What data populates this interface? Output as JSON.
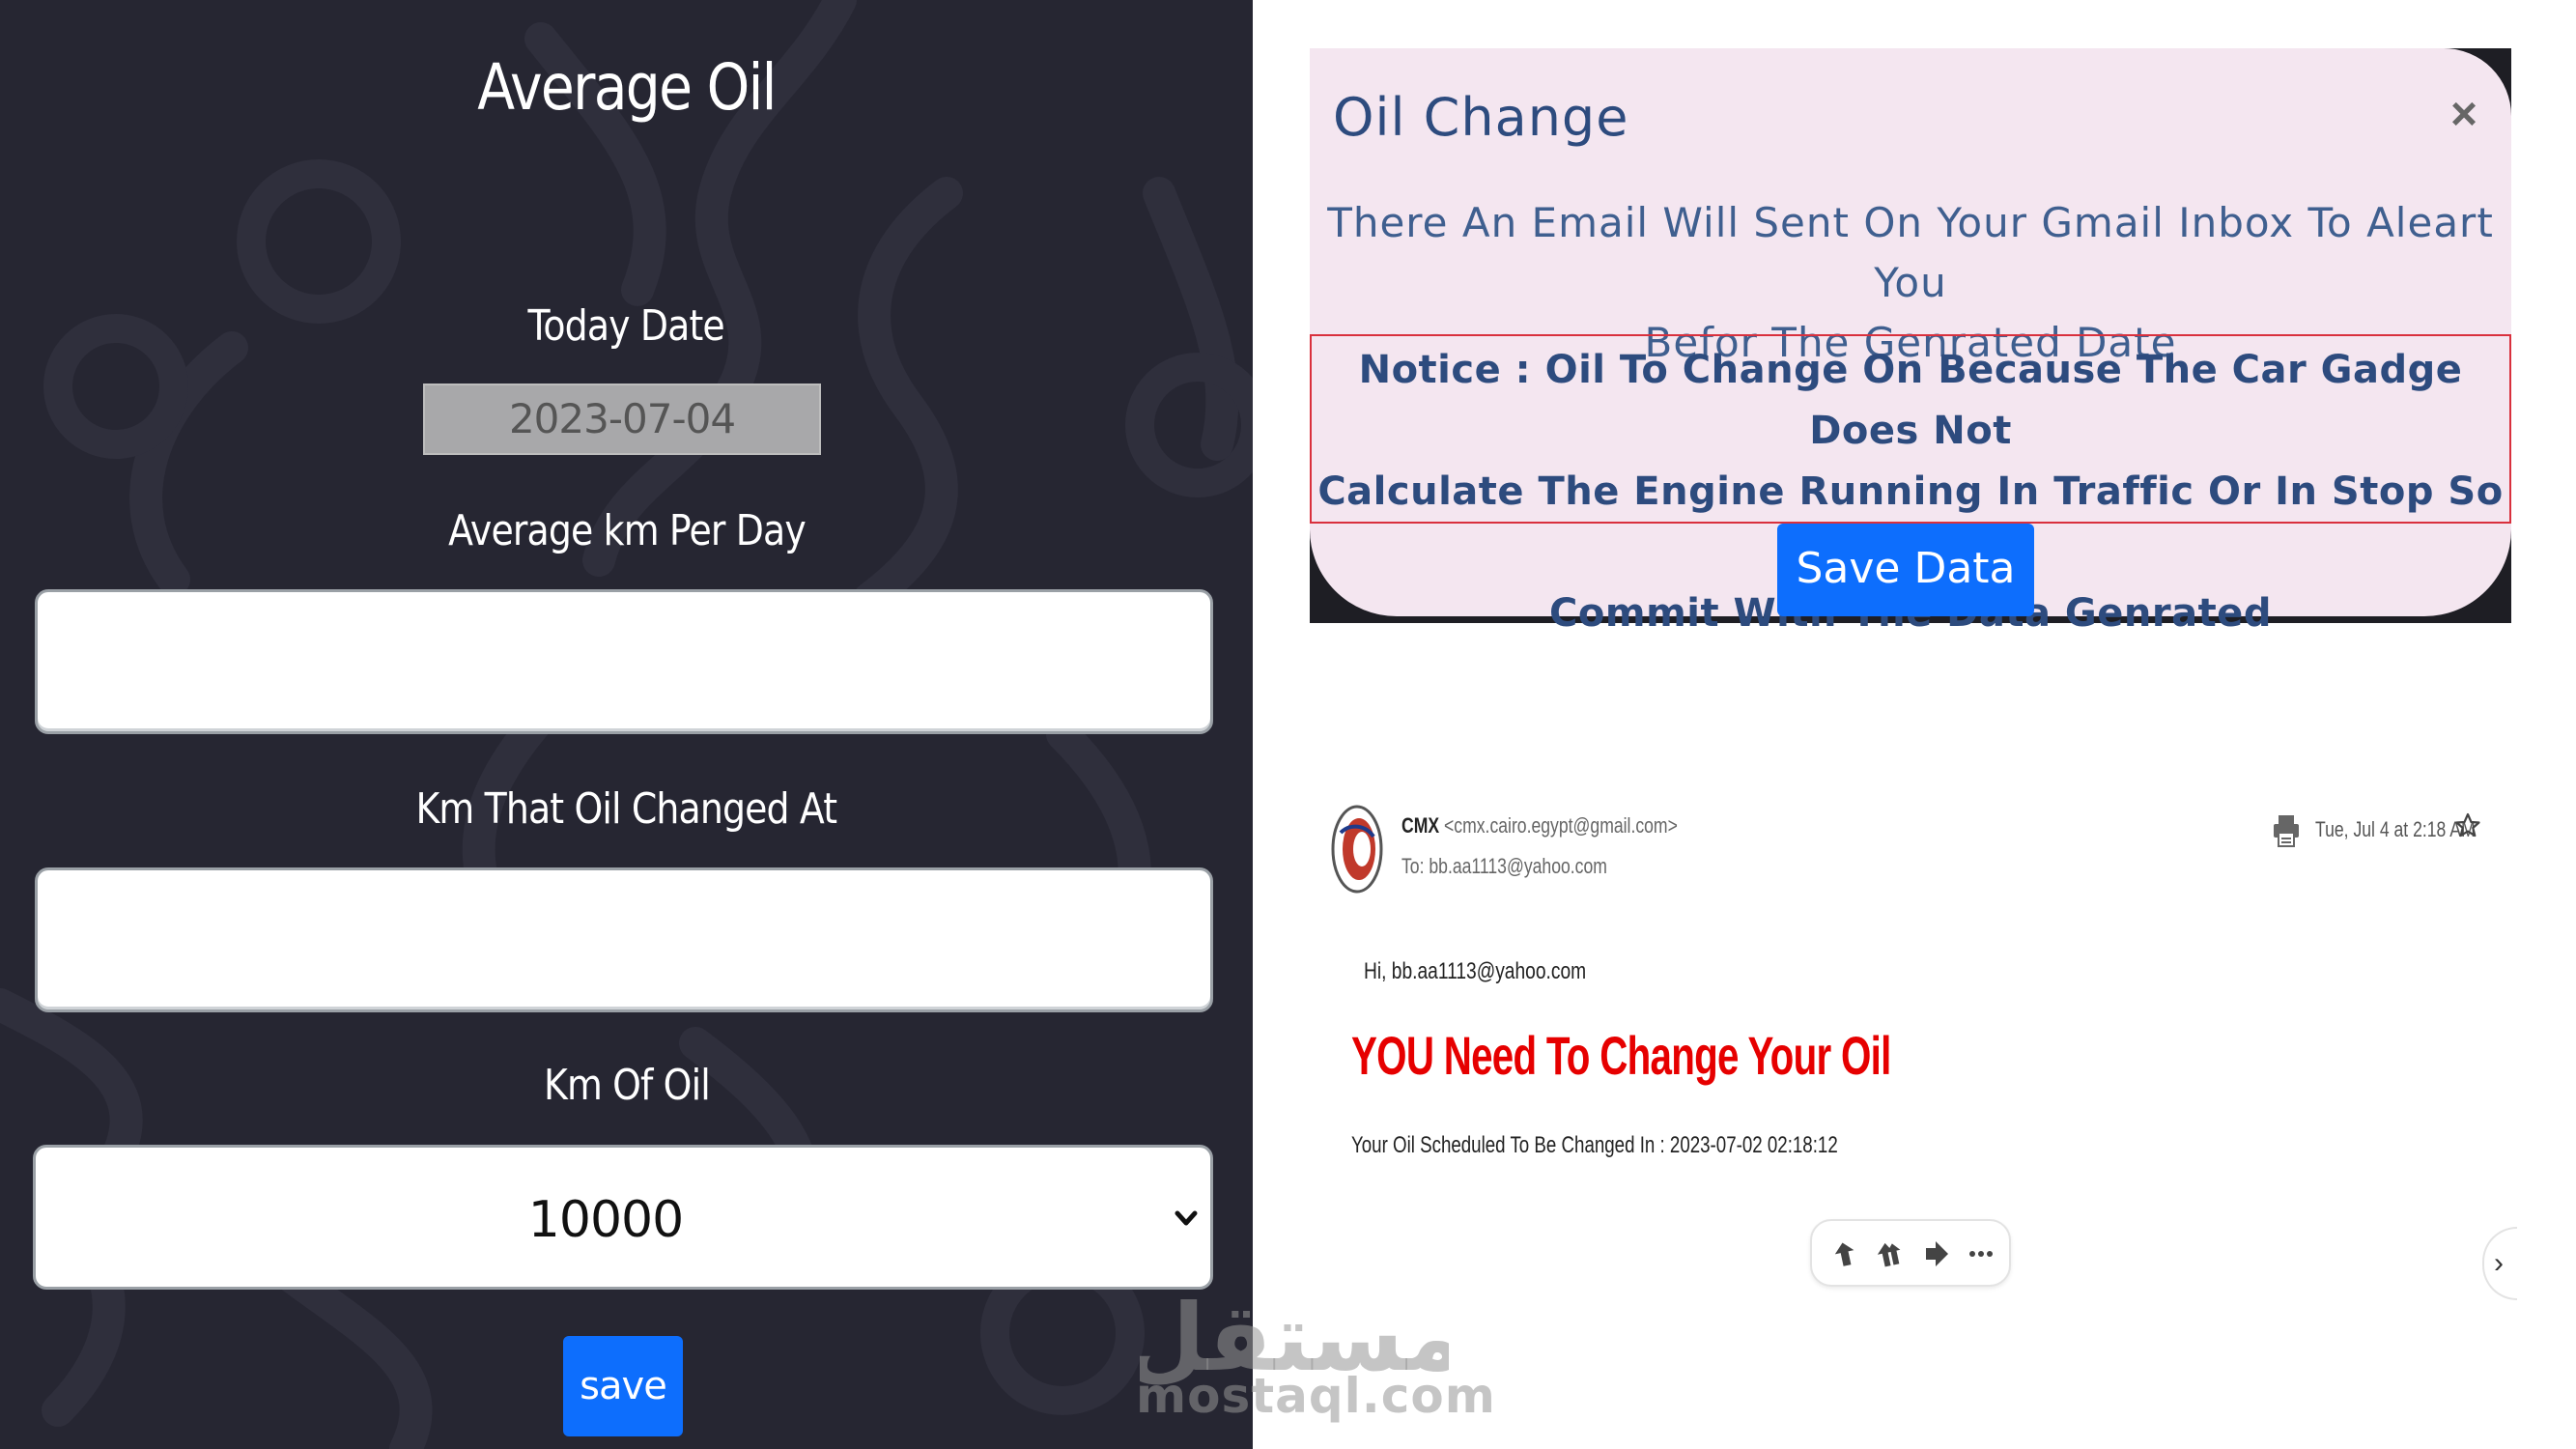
{
  "oil_form": {
    "title": "Average Oil",
    "today_date_label": "Today Date",
    "today_date_value": "2023-07-04",
    "avg_km_label": "Average km Per Day",
    "avg_km_value": "",
    "km_changed_label": "Km That Oil Changed At",
    "km_changed_value": "",
    "km_of_oil_label": "Km Of Oil",
    "km_of_oil_selected": "10000",
    "save_label": "save"
  },
  "modal": {
    "title": "Oil Change",
    "close_glyph": "×",
    "body_line1": "There An Email Will Sent On Your Gmail Inbox To Aleart You",
    "body_line2": "Befor The Genrated Date",
    "notice_line1": "Notice : Oil To Change On Because The Car Gadge Does Not",
    "notice_line2": "Calculate The Engine Running In Traffic Or In Stop So Please",
    "notice_line3": "Commit With The Data Genrated",
    "save_label": "Save Data"
  },
  "email": {
    "sender_name": "CMX",
    "sender_address": "<cmx.cairo.egypt@gmail.com>",
    "to_line": "To: bb.aa1113@yahoo.com",
    "date": "Tue, Jul 4 at 2:18 AM",
    "greeting": "Hi, bb.aa1113@yahoo.com",
    "headline": "YOU Need To Change Your Oil",
    "schedule": "Your Oil Scheduled To Be Changed In : 2023-07-02 02:18:12",
    "icons": [
      "print-icon",
      "star-icon",
      "reply-icon",
      "reply-all-icon",
      "forward-icon",
      "more-icon",
      "chevron-right-icon"
    ]
  },
  "colors": {
    "panel_bg": "#262632",
    "primary_button": "#0d6efd",
    "modal_bg": "#f4e6f0",
    "modal_text": "#2d4b7e",
    "notice_border": "#d9303d",
    "headline_red": "#e60000"
  },
  "watermark": {
    "logo_text": "مستقل",
    "site": "mostaql.com"
  }
}
